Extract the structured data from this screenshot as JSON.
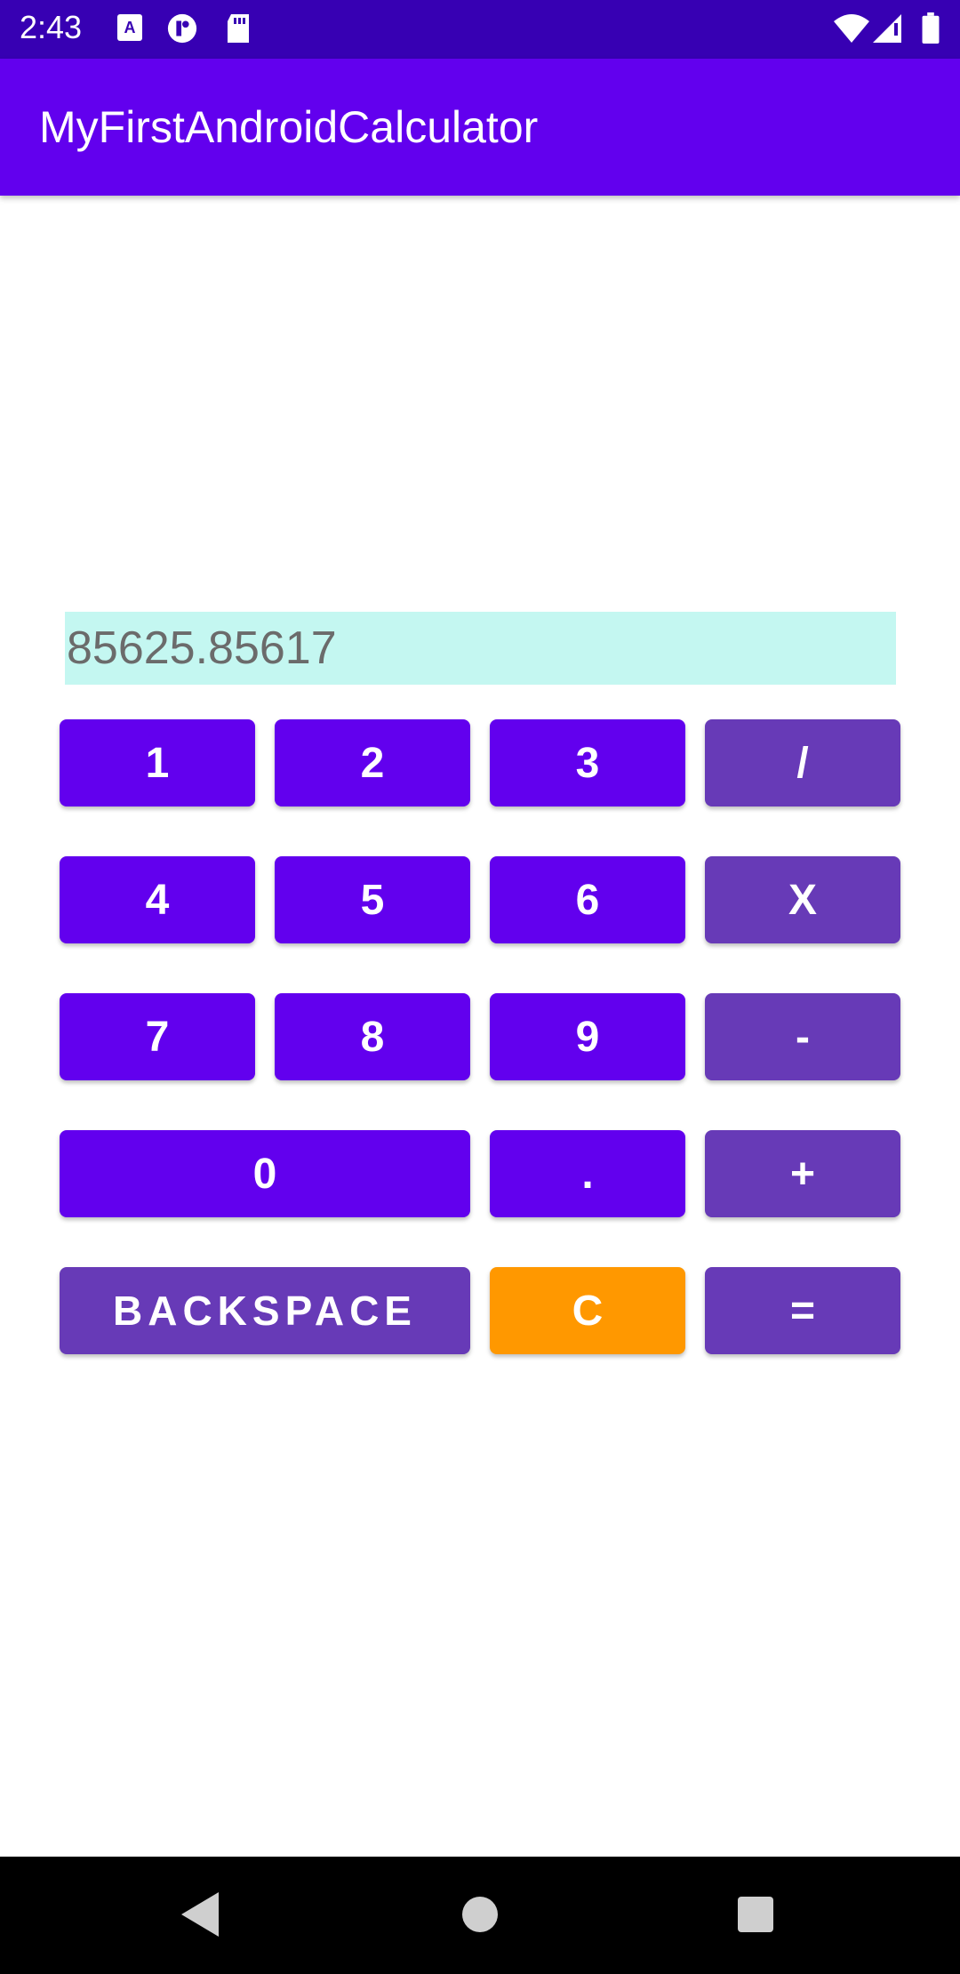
{
  "status_bar": {
    "time": "2:43",
    "left_icons": [
      "keyboard-a-icon",
      "sim-toolkit-icon",
      "sd-card-icon"
    ],
    "right_icons": [
      "wifi-icon",
      "cell-signal-icon",
      "battery-icon"
    ]
  },
  "app_bar": {
    "title": "MyFirstAndroidCalculator"
  },
  "display": {
    "value": "85625.85617"
  },
  "buttons": {
    "one": "1",
    "two": "2",
    "three": "3",
    "divide": "/",
    "four": "4",
    "five": "5",
    "six": "6",
    "multiply": "X",
    "seven": "7",
    "eight": "8",
    "nine": "9",
    "subtract": "-",
    "zero": "0",
    "decimal": ".",
    "add": "+",
    "backspace": "BACKSPACE",
    "clear": "C",
    "equals": "="
  },
  "colors": {
    "status_bar": "#3700b3",
    "app_bar": "#6200ee",
    "digit_button": "#6200ee",
    "operator_button": "#673ab7",
    "clear_button": "#ff9800",
    "display_background": "#c4f7f1"
  },
  "nav_bar": {
    "icons": [
      "back-icon",
      "home-icon",
      "recents-icon"
    ]
  }
}
